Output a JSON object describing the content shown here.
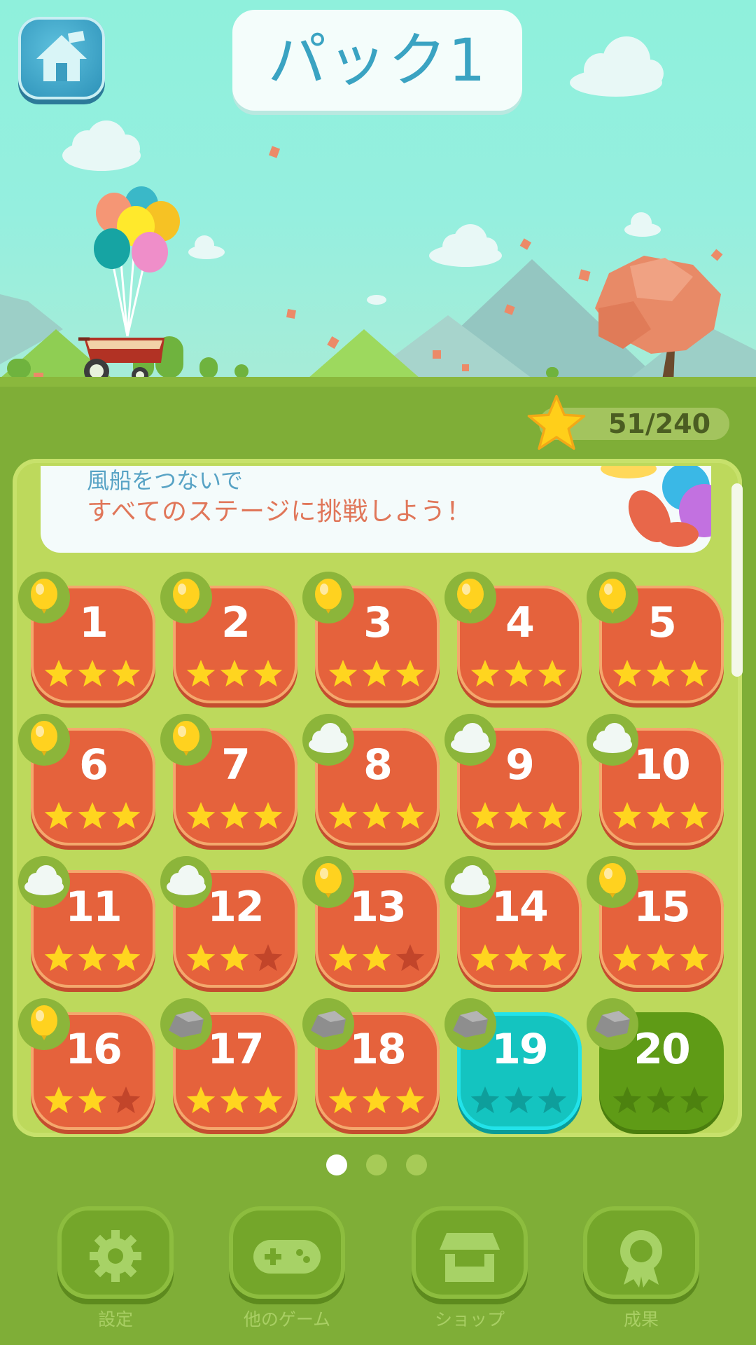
{
  "header": {
    "title": "パック1",
    "home_icon": "home-icon"
  },
  "star_counter": {
    "value": "51/240",
    "icon": "star-icon"
  },
  "message": {
    "line1": "風船をつないで",
    "line2": "すべてのステージに挑戦しよう！"
  },
  "levels": [
    {
      "number": "1",
      "stars": 3,
      "badge": "balloon",
      "state": "cleared"
    },
    {
      "number": "2",
      "stars": 3,
      "badge": "balloon",
      "state": "cleared"
    },
    {
      "number": "3",
      "stars": 3,
      "badge": "balloon",
      "state": "cleared"
    },
    {
      "number": "4",
      "stars": 3,
      "badge": "balloon",
      "state": "cleared"
    },
    {
      "number": "5",
      "stars": 3,
      "badge": "balloon",
      "state": "cleared"
    },
    {
      "number": "6",
      "stars": 3,
      "badge": "balloon",
      "state": "cleared"
    },
    {
      "number": "7",
      "stars": 3,
      "badge": "balloon",
      "state": "cleared"
    },
    {
      "number": "8",
      "stars": 3,
      "badge": "cloud",
      "state": "cleared"
    },
    {
      "number": "9",
      "stars": 3,
      "badge": "cloud",
      "state": "cleared"
    },
    {
      "number": "10",
      "stars": 3,
      "badge": "cloud",
      "state": "cleared"
    },
    {
      "number": "11",
      "stars": 3,
      "badge": "cloud",
      "state": "cleared"
    },
    {
      "number": "12",
      "stars": 2,
      "badge": "cloud",
      "state": "cleared"
    },
    {
      "number": "13",
      "stars": 2,
      "badge": "balloon",
      "state": "cleared"
    },
    {
      "number": "14",
      "stars": 3,
      "badge": "cloud",
      "state": "cleared"
    },
    {
      "number": "15",
      "stars": 3,
      "badge": "balloon",
      "state": "cleared"
    },
    {
      "number": "16",
      "stars": 2,
      "badge": "balloon",
      "state": "cleared"
    },
    {
      "number": "17",
      "stars": 3,
      "badge": "rock",
      "state": "cleared"
    },
    {
      "number": "18",
      "stars": 3,
      "badge": "rock",
      "state": "cleared"
    },
    {
      "number": "19",
      "stars": 0,
      "badge": "rock",
      "state": "current"
    },
    {
      "number": "20",
      "stars": 0,
      "badge": "rock",
      "state": "locked"
    }
  ],
  "pagination": {
    "pages": 3,
    "current": 1
  },
  "nav": [
    {
      "label": "設定",
      "icon": "gear-icon"
    },
    {
      "label": "他のゲーム",
      "icon": "gamepad-icon"
    },
    {
      "label": "ショップ",
      "icon": "shop-icon"
    },
    {
      "label": "成果",
      "icon": "award-icon"
    }
  ],
  "colors": {
    "tile_cleared": "#e5623c",
    "tile_current": "#14c4c0",
    "tile_locked": "#5f9b16",
    "star_filled": "#ffd51f",
    "title_text": "#3aa3c2"
  }
}
